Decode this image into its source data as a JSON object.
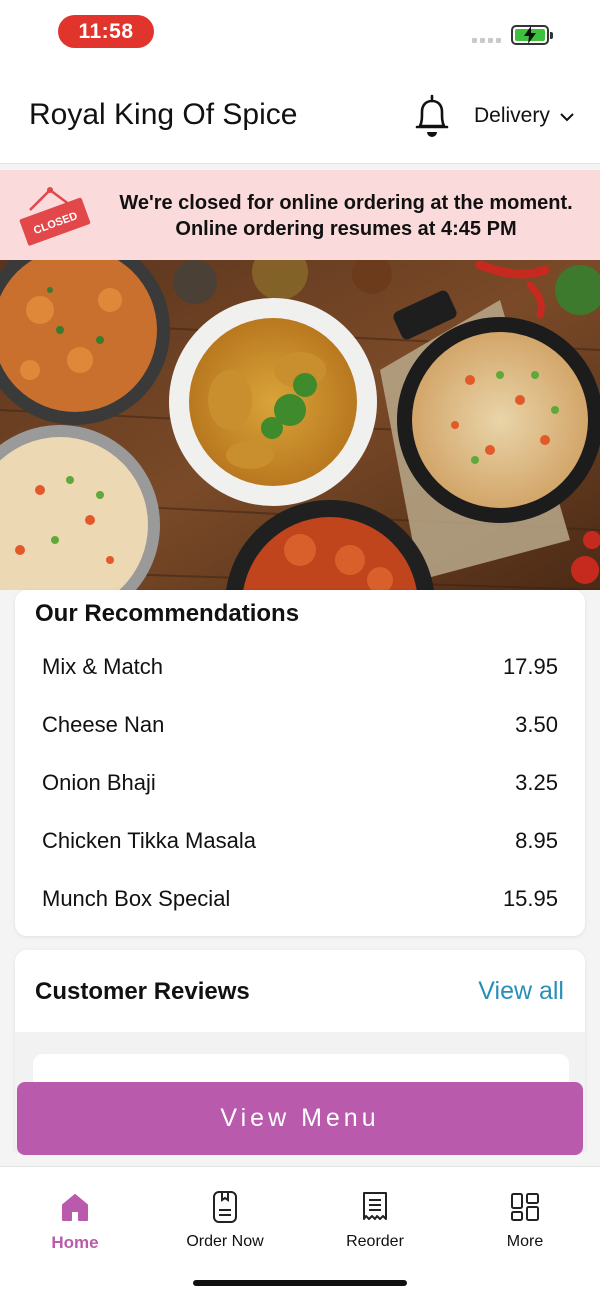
{
  "status": {
    "time": "11:58"
  },
  "header": {
    "title": "Royal King Of Spice",
    "mode": "Delivery"
  },
  "banner": {
    "sign": "CLOSED",
    "line1": "We're closed for online ordering at the moment.",
    "line2": "Online ordering resumes at 4:45 PM"
  },
  "recommendations": {
    "heading": "Our Recommendations",
    "items": [
      {
        "name": "Mix & Match",
        "price": "17.95"
      },
      {
        "name": "Cheese Nan",
        "price": "3.50"
      },
      {
        "name": "Onion Bhaji",
        "price": "3.25"
      },
      {
        "name": "Chicken Tikka Masala",
        "price": "8.95"
      },
      {
        "name": "Munch Box Special",
        "price": "15.95"
      }
    ]
  },
  "reviews": {
    "heading": "Customer Reviews",
    "view_all": "View all"
  },
  "cta": {
    "view_menu": "View Menu"
  },
  "tabs": [
    {
      "label": "Home",
      "icon": "home-icon",
      "active": true
    },
    {
      "label": "Order Now",
      "icon": "order-now-icon",
      "active": false
    },
    {
      "label": "Reorder",
      "icon": "receipt-icon",
      "active": false
    },
    {
      "label": "More",
      "icon": "grid-icon",
      "active": false
    }
  ],
  "colors": {
    "accent": "#b95aac",
    "link": "#2a8fb6",
    "banner_bg": "#fadada",
    "time_pill": "#e0342c"
  }
}
